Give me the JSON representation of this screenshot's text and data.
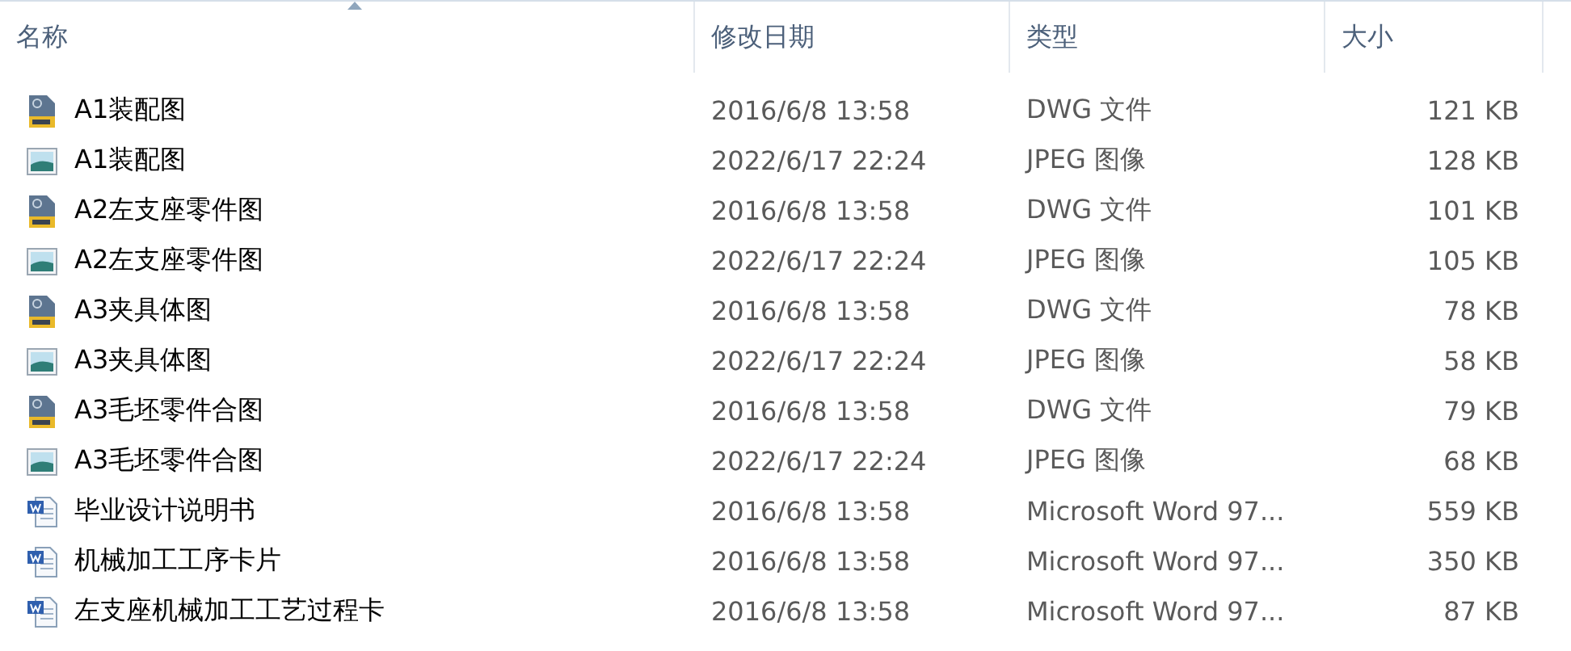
{
  "table": {
    "columns": [
      {
        "label": "名称",
        "sorted": true
      },
      {
        "label": "修改日期",
        "sorted": false
      },
      {
        "label": "类型",
        "sorted": false
      },
      {
        "label": "大小",
        "sorted": false
      }
    ],
    "rows": [
      {
        "kind": "dwg",
        "name": "A1装配图",
        "date": "2016/6/8 13:58",
        "type": "DWG 文件",
        "size": "121 KB"
      },
      {
        "kind": "jpeg",
        "name": "A1装配图",
        "date": "2022/6/17 22:24",
        "type": "JPEG 图像",
        "size": "128 KB"
      },
      {
        "kind": "dwg",
        "name": "A2左支座零件图",
        "date": "2016/6/8 13:58",
        "type": "DWG 文件",
        "size": "101 KB"
      },
      {
        "kind": "jpeg",
        "name": "A2左支座零件图",
        "date": "2022/6/17 22:24",
        "type": "JPEG 图像",
        "size": "105 KB"
      },
      {
        "kind": "dwg",
        "name": "A3夹具体图",
        "date": "2016/6/8 13:58",
        "type": "DWG 文件",
        "size": "78 KB"
      },
      {
        "kind": "jpeg",
        "name": "A3夹具体图",
        "date": "2022/6/17 22:24",
        "type": "JPEG 图像",
        "size": "58 KB"
      },
      {
        "kind": "dwg",
        "name": "A3毛坯零件合图",
        "date": "2016/6/8 13:58",
        "type": "DWG 文件",
        "size": "79 KB"
      },
      {
        "kind": "jpeg",
        "name": "A3毛坯零件合图",
        "date": "2022/6/17 22:24",
        "type": "JPEG 图像",
        "size": "68 KB"
      },
      {
        "kind": "word",
        "name": "毕业设计说明书",
        "date": "2016/6/8 13:58",
        "type": "Microsoft Word 97...",
        "size": "559 KB"
      },
      {
        "kind": "word",
        "name": "机械加工工序卡片",
        "date": "2016/6/8 13:58",
        "type": "Microsoft Word 97...",
        "size": "350 KB"
      },
      {
        "kind": "word",
        "name": "左支座机械加工工艺过程卡",
        "date": "2016/6/8 13:58",
        "type": "Microsoft Word 97...",
        "size": "87 KB"
      }
    ]
  }
}
